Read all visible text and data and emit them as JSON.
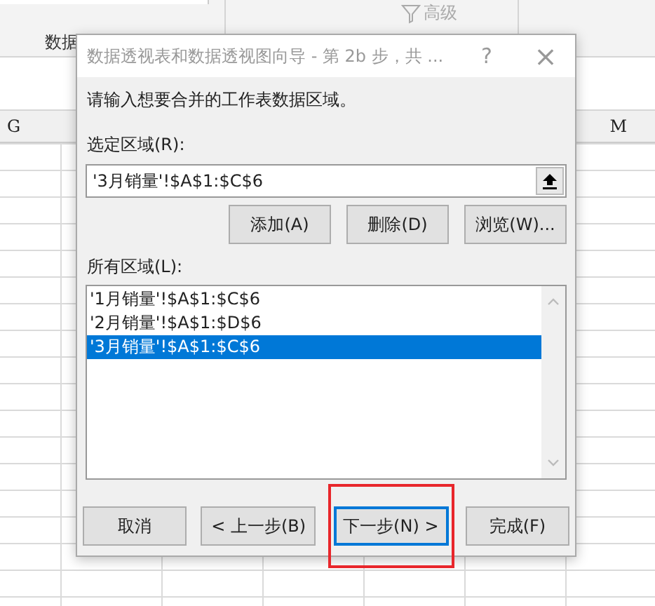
{
  "ribbon": {
    "group_label": "数据",
    "advanced_button": "高级"
  },
  "columns": [
    "G",
    "M"
  ],
  "dialog": {
    "title": "数据透视表和数据透视图向导 - 第 2b 步，共 ...",
    "help": "?",
    "close": "×",
    "instruction": "请输入想要合并的工作表数据区域。",
    "range_label": "选定区域(R):",
    "range_value": "'3月销量'!$A$1:$C$6",
    "range_buttons": [
      "添加(A)",
      "删除(D)",
      "浏览(W)..."
    ],
    "all_label": "所有区域(L):",
    "ranges": [
      {
        "text": "'1月销量'!$A$1:$C$6",
        "selected": false
      },
      {
        "text": "'2月销量'!$A$1:$D$6",
        "selected": false
      },
      {
        "text": "'3月销量'!$A$1:$C$6",
        "selected": true
      }
    ],
    "buttons": [
      {
        "label": "取消",
        "default": false,
        "highlighted": false
      },
      {
        "label": "< 上一步(B)",
        "default": false,
        "highlighted": false
      },
      {
        "label": "下一步(N) >",
        "default": true,
        "highlighted": true
      },
      {
        "label": "完成(F)",
        "default": false,
        "highlighted": false
      }
    ]
  }
}
